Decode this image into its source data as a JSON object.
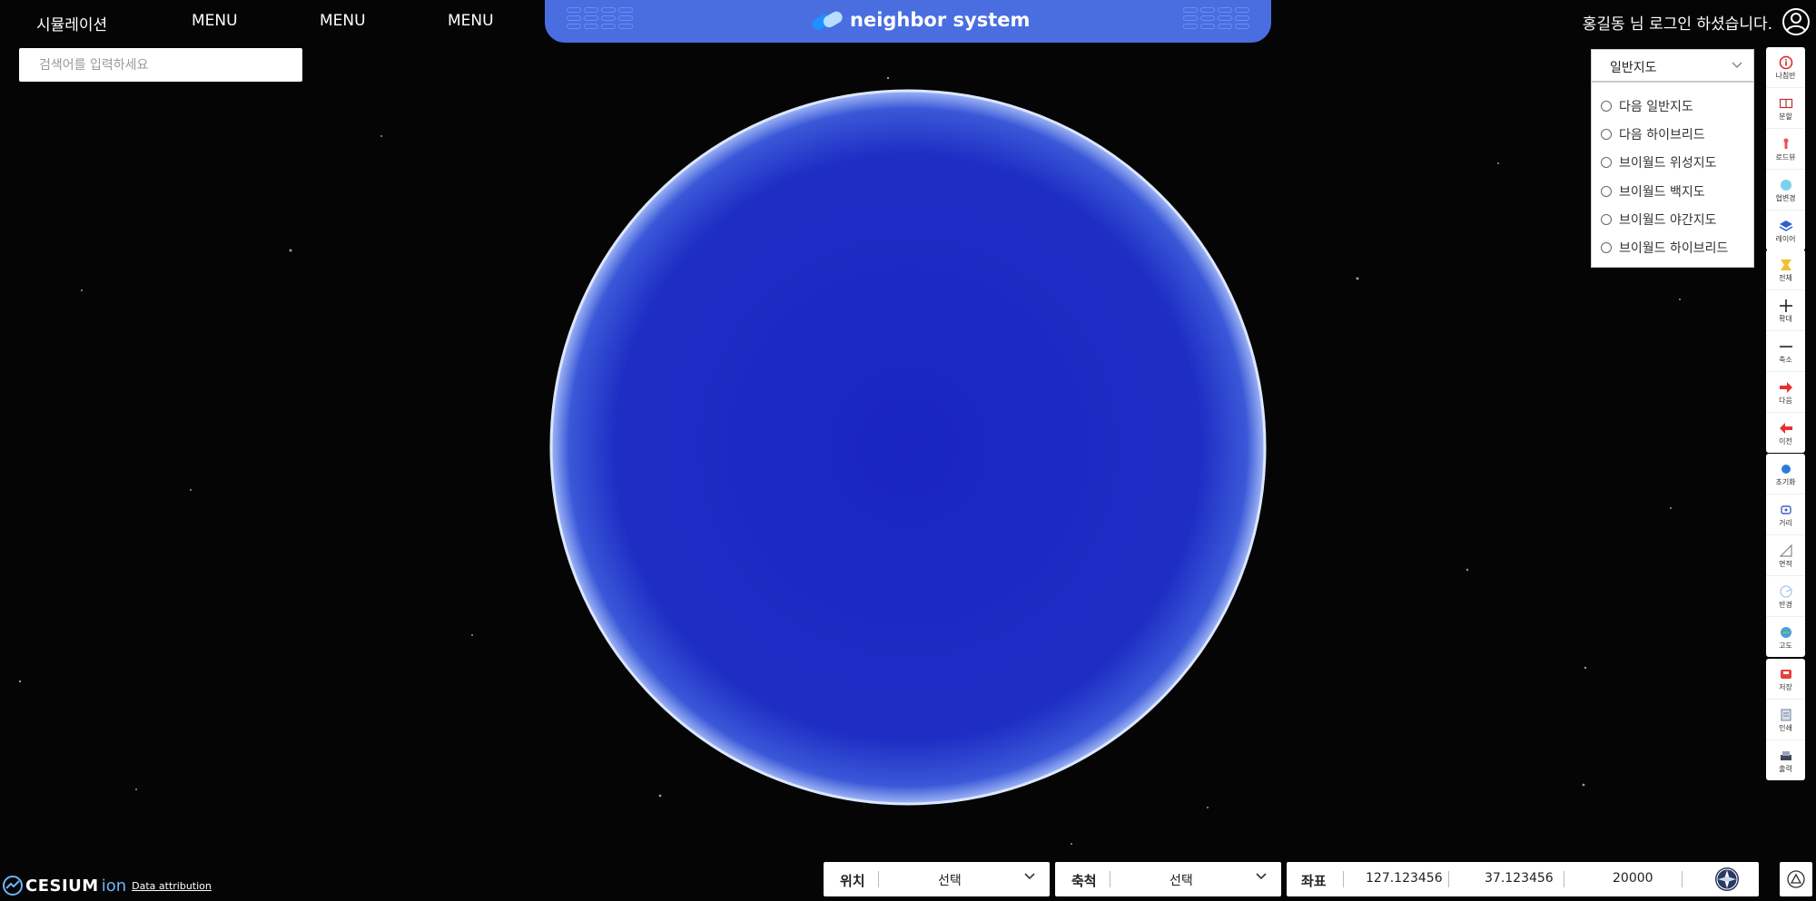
{
  "header": {
    "menu": [
      "시뮬레이션",
      "MENU",
      "MENU",
      "MENU"
    ],
    "brand": "neighbor system",
    "user_message": "홍길동 님 로그인 하셨습니다."
  },
  "search": {
    "placeholder": "검색어를 입력하세요"
  },
  "layer": {
    "selected": "일반지도",
    "options": [
      "다음 일반지도",
      "다음 하이브리드",
      "브이월드 위성지도",
      "브이월드 백지도",
      "브이월드 야간지도",
      "브이월드 하이브리드"
    ]
  },
  "toolbar": {
    "group1": [
      {
        "icon": "info-icon",
        "label": "나침반"
      },
      {
        "icon": "split-icon",
        "label": "분할"
      },
      {
        "icon": "roadview-icon",
        "label": "로드뷰"
      },
      {
        "icon": "environment-icon",
        "label": "협변경"
      },
      {
        "icon": "layers-icon",
        "label": "레이어"
      }
    ],
    "group2": [
      {
        "icon": "fullextent-icon",
        "label": "전체"
      },
      {
        "icon": "zoom-in-icon",
        "label": "확대"
      },
      {
        "icon": "zoom-out-icon",
        "label": "축소"
      },
      {
        "icon": "next-icon",
        "label": "다음"
      },
      {
        "icon": "previous-icon",
        "label": "이전"
      }
    ],
    "group3": [
      {
        "icon": "reset-icon",
        "label": "초기화"
      },
      {
        "icon": "distance-icon",
        "label": "거리"
      },
      {
        "icon": "area-icon",
        "label": "면적"
      },
      {
        "icon": "radius-icon",
        "label": "반경"
      },
      {
        "icon": "altitude-icon",
        "label": "고도"
      }
    ],
    "group4": [
      {
        "icon": "save-icon",
        "label": "저장"
      },
      {
        "icon": "print-icon",
        "label": "인쇄"
      },
      {
        "icon": "output-icon",
        "label": "출력"
      }
    ]
  },
  "bottom": {
    "location_label": "위치",
    "location_value": "선택",
    "scale_label": "축척",
    "scale_value": "선택",
    "coord_label": "좌표",
    "coord_x": "127.123456",
    "coord_y": "37.123456",
    "coord_z": "20000"
  },
  "footer": {
    "cesium": "CESIUM",
    "ion": "ion",
    "attribution": "Data attribution"
  },
  "colors": {
    "brand_bar": "#4a6ee0",
    "globe": "#1a28c0",
    "background": "#050505"
  }
}
